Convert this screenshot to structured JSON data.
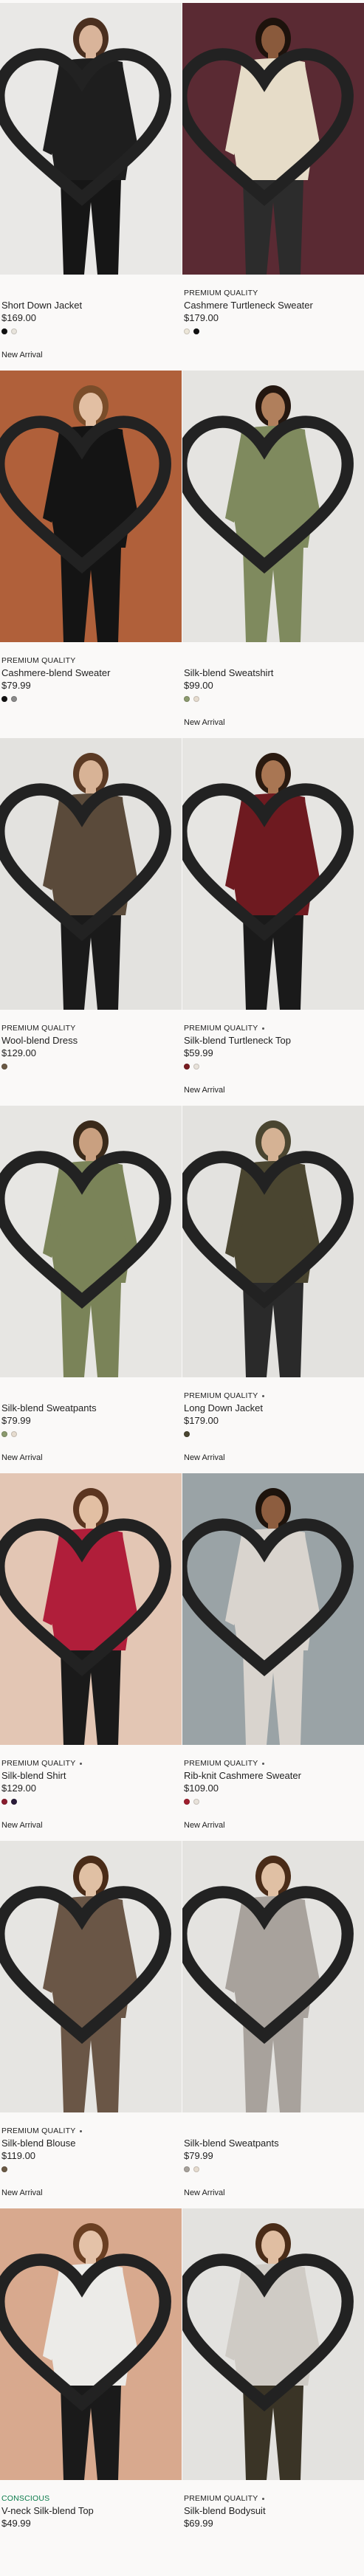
{
  "products": [
    {
      "badge": "",
      "title": "Short Down Jacket",
      "price": "$169.00",
      "swatches": [
        "#111111",
        "#e8e4dc"
      ],
      "new": "New Arrival",
      "bg": "#e9e8e6",
      "fig": "#1e1e1e",
      "skin": "#d9b49a",
      "hair": "#4a2f1f",
      "legs": "#161616"
    },
    {
      "badge": "PREMIUM QUALITY",
      "title": "Cashmere Turtleneck Sweater",
      "price": "$179.00",
      "swatches": [
        "#ece6d8",
        "#111111"
      ],
      "new": "",
      "bg": "#5a2a33",
      "fig": "#e6dcc8",
      "skin": "#8a5a3c",
      "hair": "#1d120c",
      "legs": "#2c2c2c"
    },
    {
      "badge": "PREMIUM QUALITY",
      "title": "Cashmere-blend Sweater",
      "price": "$79.99",
      "swatches": [
        "#111111",
        "#8a8a8a"
      ],
      "new": "",
      "bg": "#b0603a",
      "fig": "#141414",
      "skin": "#e2bfa3",
      "hair": "#7a4d2a",
      "legs": "#141414"
    },
    {
      "badge": "",
      "title": "Silk-blend Sweatshirt",
      "price": "$99.00",
      "swatches": [
        "#8c9a6e",
        "#e6dccf"
      ],
      "new": "New Arrival",
      "bg": "#e5e4e1",
      "fig": "#7f8a5e",
      "skin": "#b07f5c",
      "hair": "#241710",
      "legs": "#7f8a5e"
    },
    {
      "badge": "PREMIUM QUALITY",
      "title": "Wool-blend Dress",
      "price": "$129.00",
      "swatches": [
        "#6b5a45"
      ],
      "new": "",
      "bg": "#e3e2df",
      "fig": "#5a4a3a",
      "skin": "#d8b396",
      "hair": "#5b3a24",
      "legs": "#1a1a1a"
    },
    {
      "badge": "PREMIUM QUALITY",
      "title": "Silk-blend Turtleneck Top",
      "price": "$59.99",
      "swatches": [
        "#7a1d22",
        "#e8e2da"
      ],
      "new": "New Arrival",
      "bg": "#e6e5e2",
      "fig": "#6e1a20",
      "skin": "#a97653",
      "hair": "#2a1a10",
      "legs": "#1a1a1a"
    },
    {
      "badge": "",
      "title": "Silk-blend Sweatpants",
      "price": "$79.99",
      "swatches": [
        "#8c9a6e",
        "#e6dccf"
      ],
      "new": "New Arrival",
      "bg": "#e7e6e3",
      "fig": "#7a8358",
      "skin": "#c9a080",
      "hair": "#3a2a1a",
      "legs": "#7a8358"
    },
    {
      "badge": "PREMIUM QUALITY",
      "title": "Long Down Jacket",
      "price": "$179.00",
      "swatches": [
        "#4a4632"
      ],
      "new": "New Arrival",
      "bg": "#e3e2df",
      "fig": "#4a4530",
      "skin": "#d5b294",
      "hair": "#4a4530",
      "legs": "#2a2a2a"
    },
    {
      "badge": "PREMIUM QUALITY",
      "title": "Silk-blend Shirt",
      "price": "$129.00",
      "swatches": [
        "#8a1d2f",
        "#2a1c3a"
      ],
      "new": "New Arrival",
      "bg": "#e3c6b4",
      "fig": "#b01e3a",
      "skin": "#e2bfa3",
      "hair": "#5b3520",
      "legs": "#1a1a1a"
    },
    {
      "badge": "PREMIUM QUALITY",
      "title": "Rib-knit Cashmere Sweater",
      "price": "$109.00",
      "swatches": [
        "#a01e2e",
        "#e8e2da"
      ],
      "new": "New Arrival",
      "bg": "#9aa3a6",
      "fig": "#d9d4ce",
      "skin": "#8d5d3f",
      "hair": "#1d130c",
      "legs": "#d9d4ce"
    },
    {
      "badge": "PREMIUM QUALITY",
      "title": "Silk-blend Blouse",
      "price": "$119.00",
      "swatches": [
        "#6b5a45"
      ],
      "new": "New Arrival",
      "bg": "#e6e5e2",
      "fig": "#6a5646",
      "skin": "#e0c0a4",
      "hair": "#4a2c18",
      "legs": "#6a5646"
    },
    {
      "badge": "",
      "title": "Silk-blend Sweatpants",
      "price": "$79.99",
      "swatches": [
        "#a7a29b",
        "#e6dccf"
      ],
      "new": "New Arrival",
      "bg": "#e4e3e0",
      "fig": "#a8a29c",
      "skin": "#e0c0a4",
      "hair": "#4a2c18",
      "legs": "#a8a29c"
    },
    {
      "badge": "CONSCIOUS",
      "title": "V-neck Silk-blend Top",
      "price": "$49.99",
      "swatches": [],
      "new": "",
      "bg": "#d8a98e",
      "fig": "#ecebe8",
      "skin": "#e4c2a8",
      "hair": "#6a3f22",
      "legs": "#1a1a1a"
    },
    {
      "badge": "PREMIUM QUALITY",
      "title": "Silk-blend Bodysuit",
      "price": "$69.99",
      "swatches": [],
      "new": "",
      "bg": "#e3e2df",
      "fig": "#cfcbc5",
      "skin": "#e0bea2",
      "hair": "#4a2c18",
      "legs": "#3a3426"
    }
  ]
}
